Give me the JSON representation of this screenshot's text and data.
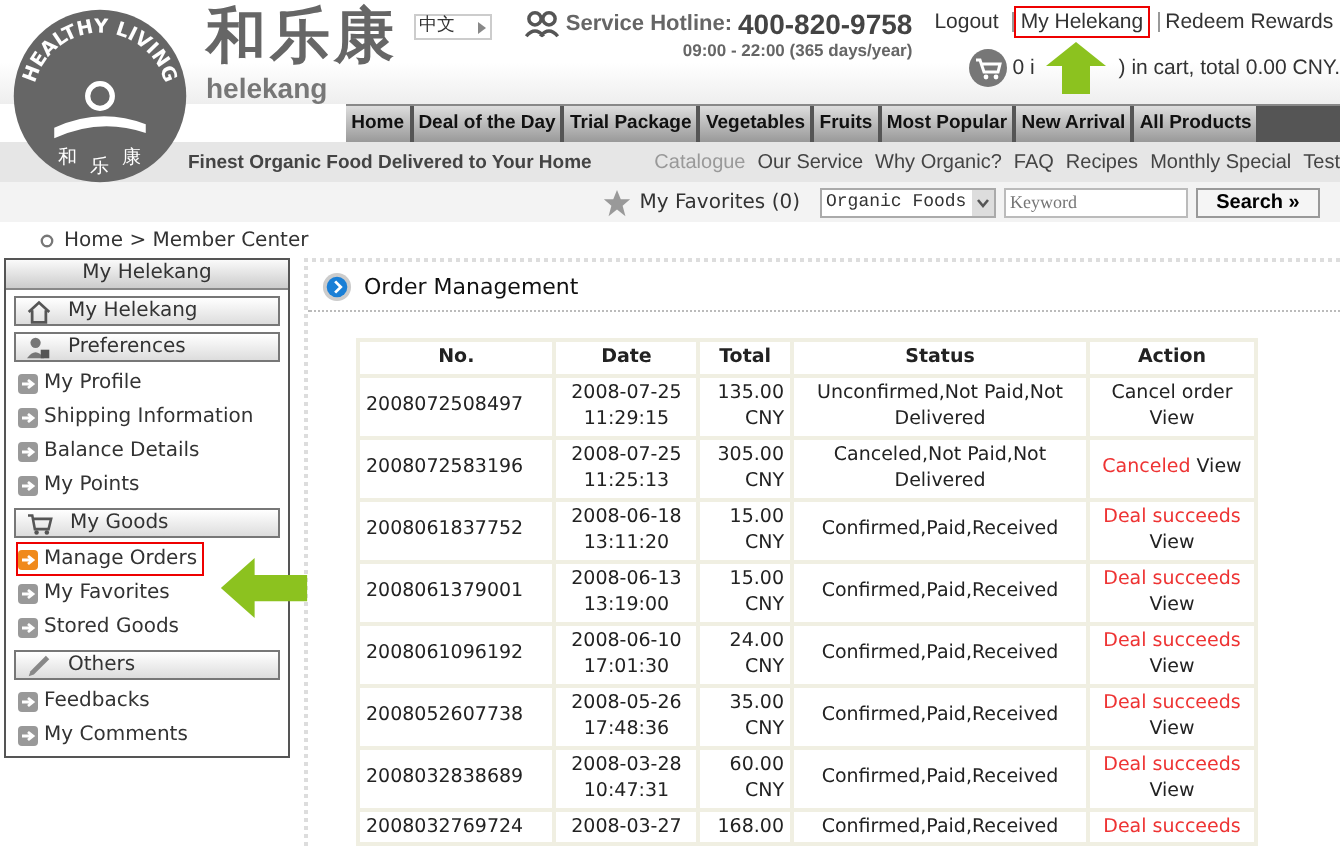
{
  "logo": {
    "arc_text": "HEALTHY LIVING",
    "seal_chars": [
      "和",
      "乐",
      "康"
    ],
    "brand_cn": "和乐康",
    "brand_en": "helekang"
  },
  "language": "中文",
  "hotline": {
    "label": "Service Hotline:",
    "number": "400-820-9758",
    "hours": "09:00 - 22:00 (365 days/year)"
  },
  "top_links": [
    {
      "label": "Logout",
      "highlighted": false
    },
    {
      "label": "My Helekang",
      "highlighted": true
    },
    {
      "label": "Redeem Rewards",
      "highlighted": false
    }
  ],
  "cart": {
    "before": "0 i",
    "after": ") in cart, total 0.00 CNY."
  },
  "nav_tabs": [
    "Home",
    "Deal of the Day",
    "Trial Package",
    "Vegetables",
    "Fruits",
    "Most Popular",
    "New Arrival",
    "All Products"
  ],
  "tagline": "Finest Organic Food Delivered to Your Home",
  "sub_links": [
    {
      "label": "Catalogue",
      "selected": true
    },
    {
      "label": "Our Service",
      "selected": false
    },
    {
      "label": "Why Organic?",
      "selected": false
    },
    {
      "label": "FAQ",
      "selected": false
    },
    {
      "label": "Recipes",
      "selected": false
    },
    {
      "label": "Monthly Special",
      "selected": false
    },
    {
      "label": "Test",
      "selected": false
    }
  ],
  "search": {
    "favorites": "My Favorites (0)",
    "category": "Organic Foods",
    "placeholder": "Keyword",
    "button": "Search »"
  },
  "breadcrumb": "Home > Member Center",
  "sidebar": {
    "title": "My Helekang",
    "sections": [
      {
        "heading": "My Helekang",
        "kind": "home"
      },
      {
        "heading": "Preferences",
        "kind": "user",
        "items": [
          {
            "label": "My Profile",
            "selected": false
          },
          {
            "label": "Shipping Information",
            "selected": false
          },
          {
            "label": "Balance Details",
            "selected": false
          },
          {
            "label": "My Points",
            "selected": false
          }
        ]
      },
      {
        "heading": "My Goods",
        "kind": "cart",
        "items": [
          {
            "label": "Manage Orders",
            "selected": true
          },
          {
            "label": "My Favorites",
            "selected": false
          },
          {
            "label": "Stored Goods",
            "selected": false
          }
        ]
      },
      {
        "heading": "Others",
        "kind": "pencil",
        "items": [
          {
            "label": "Feedbacks",
            "selected": false
          },
          {
            "label": "My Comments",
            "selected": false
          }
        ]
      }
    ]
  },
  "panel_title": "Order Management",
  "table": {
    "columns": [
      "No.",
      "Date",
      "Total",
      "Status",
      "Action"
    ],
    "rows": [
      {
        "no": "2008072508497",
        "date": "2008-07-25",
        "time": "11:29:15",
        "total": "135.00",
        "currency": "CNY",
        "status": "Unconfirmed,Not Paid,Not Delivered",
        "action": {
          "kind": "cancel",
          "label": "Cancel order",
          "view": "View"
        }
      },
      {
        "no": "2008072583196",
        "date": "2008-07-25",
        "time": "11:25:13",
        "total": "305.00",
        "currency": "CNY",
        "status": "Canceled,Not Paid,Not Delivered",
        "action": {
          "kind": "canceled",
          "label": "Canceled",
          "view": "View"
        }
      },
      {
        "no": "2008061837752",
        "date": "2008-06-18",
        "time": "13:11:20",
        "total": "15.00",
        "currency": "CNY",
        "status": "Confirmed,Paid,Received",
        "action": {
          "kind": "success",
          "label": "Deal succeeds",
          "view": "View"
        }
      },
      {
        "no": "2008061379001",
        "date": "2008-06-13",
        "time": "13:19:00",
        "total": "15.00",
        "currency": "CNY",
        "status": "Confirmed,Paid,Received",
        "action": {
          "kind": "success",
          "label": "Deal succeeds",
          "view": "View"
        }
      },
      {
        "no": "2008061096192",
        "date": "2008-06-10",
        "time": "17:01:30",
        "total": "24.00",
        "currency": "CNY",
        "status": "Confirmed,Paid,Received",
        "action": {
          "kind": "success",
          "label": "Deal succeeds",
          "view": "View"
        }
      },
      {
        "no": "2008052607738",
        "date": "2008-05-26",
        "time": "17:48:36",
        "total": "35.00",
        "currency": "CNY",
        "status": "Confirmed,Paid,Received",
        "action": {
          "kind": "success",
          "label": "Deal succeeds",
          "view": "View"
        }
      },
      {
        "no": "2008032838689",
        "date": "2008-03-28",
        "time": "10:47:31",
        "total": "60.00",
        "currency": "CNY",
        "status": "Confirmed,Paid,Received",
        "action": {
          "kind": "success",
          "label": "Deal succeeds",
          "view": "View"
        }
      },
      {
        "no": "2008032769724",
        "date": "2008-03-27",
        "total": "168.00",
        "status": "Confirmed,Paid,Received",
        "action": {
          "kind": "success",
          "label": "Deal succeeds"
        }
      }
    ]
  }
}
